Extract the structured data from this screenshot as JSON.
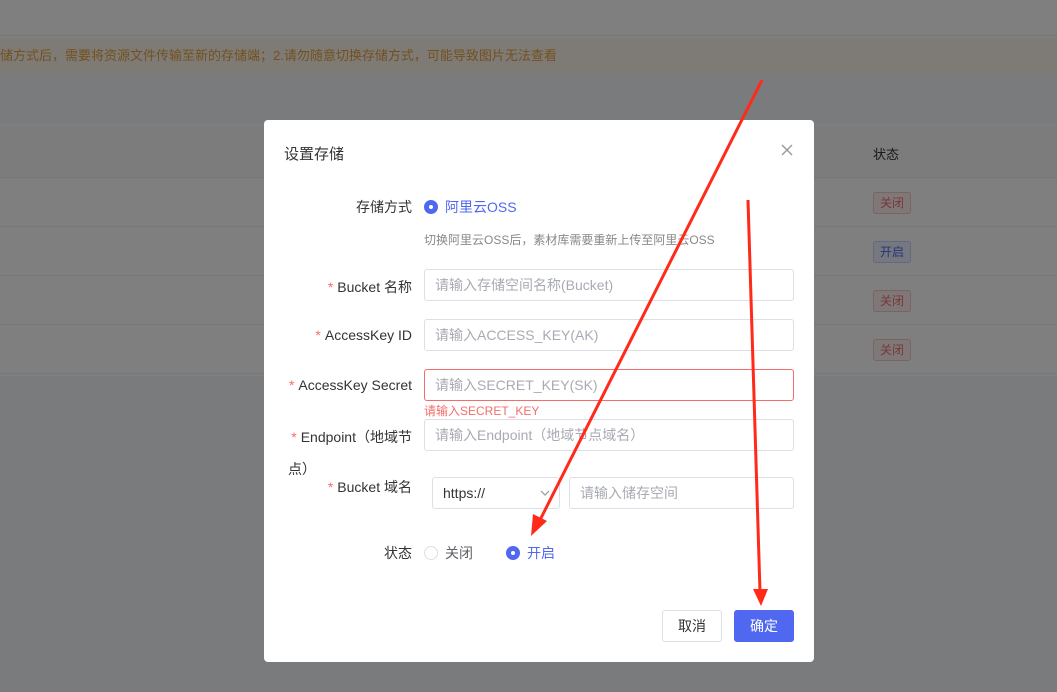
{
  "background": {
    "notice": "储方式后，需要将资源文件传输至新的存储端；2.请勿随意切换存储方式，可能导致图片无法查看",
    "table_header_status": "状态",
    "rows": [
      {
        "status": "关闭",
        "state": "off"
      },
      {
        "status": "开启",
        "state": "on"
      },
      {
        "status": "关闭",
        "state": "off"
      },
      {
        "status": "关闭",
        "state": "off"
      }
    ]
  },
  "modal": {
    "title": "设置存储",
    "storage_method_label": "存储方式",
    "storage_method_option": "阿里云OSS",
    "storage_hint": "切换阿里云OSS后，素材库需要重新上传至阿里云OSS",
    "bucket_name_label": "Bucket 名称",
    "bucket_name_placeholder": "请输入存储空间名称(Bucket)",
    "access_key_id_label": "AccessKey ID",
    "access_key_id_placeholder": "请输入ACCESS_KEY(AK)",
    "access_key_secret_label": "AccessKey Secret",
    "access_key_secret_placeholder": "请输入SECRET_KEY(SK)",
    "access_key_secret_error": "请输入SECRET_KEY",
    "endpoint_label_line1": "Endpoint（地域节",
    "endpoint_label_line2": "点）",
    "endpoint_placeholder": "请输入Endpoint（地域节点域名）",
    "bucket_domain_label": "Bucket 域名",
    "protocol_value": "https://",
    "bucket_domain_placeholder": "请输入储存空间",
    "status_label": "状态",
    "status_off": "关闭",
    "status_on": "开启",
    "status_selected": "开启",
    "cancel_button": "取消",
    "ok_button": "确定"
  },
  "colors": {
    "primary": "#5068f0",
    "error": "#f56c6c",
    "warning": "#e6a23c",
    "annotation_arrow": "#ff2a1a"
  },
  "icons": [
    "close-icon",
    "chevron-down-icon"
  ]
}
